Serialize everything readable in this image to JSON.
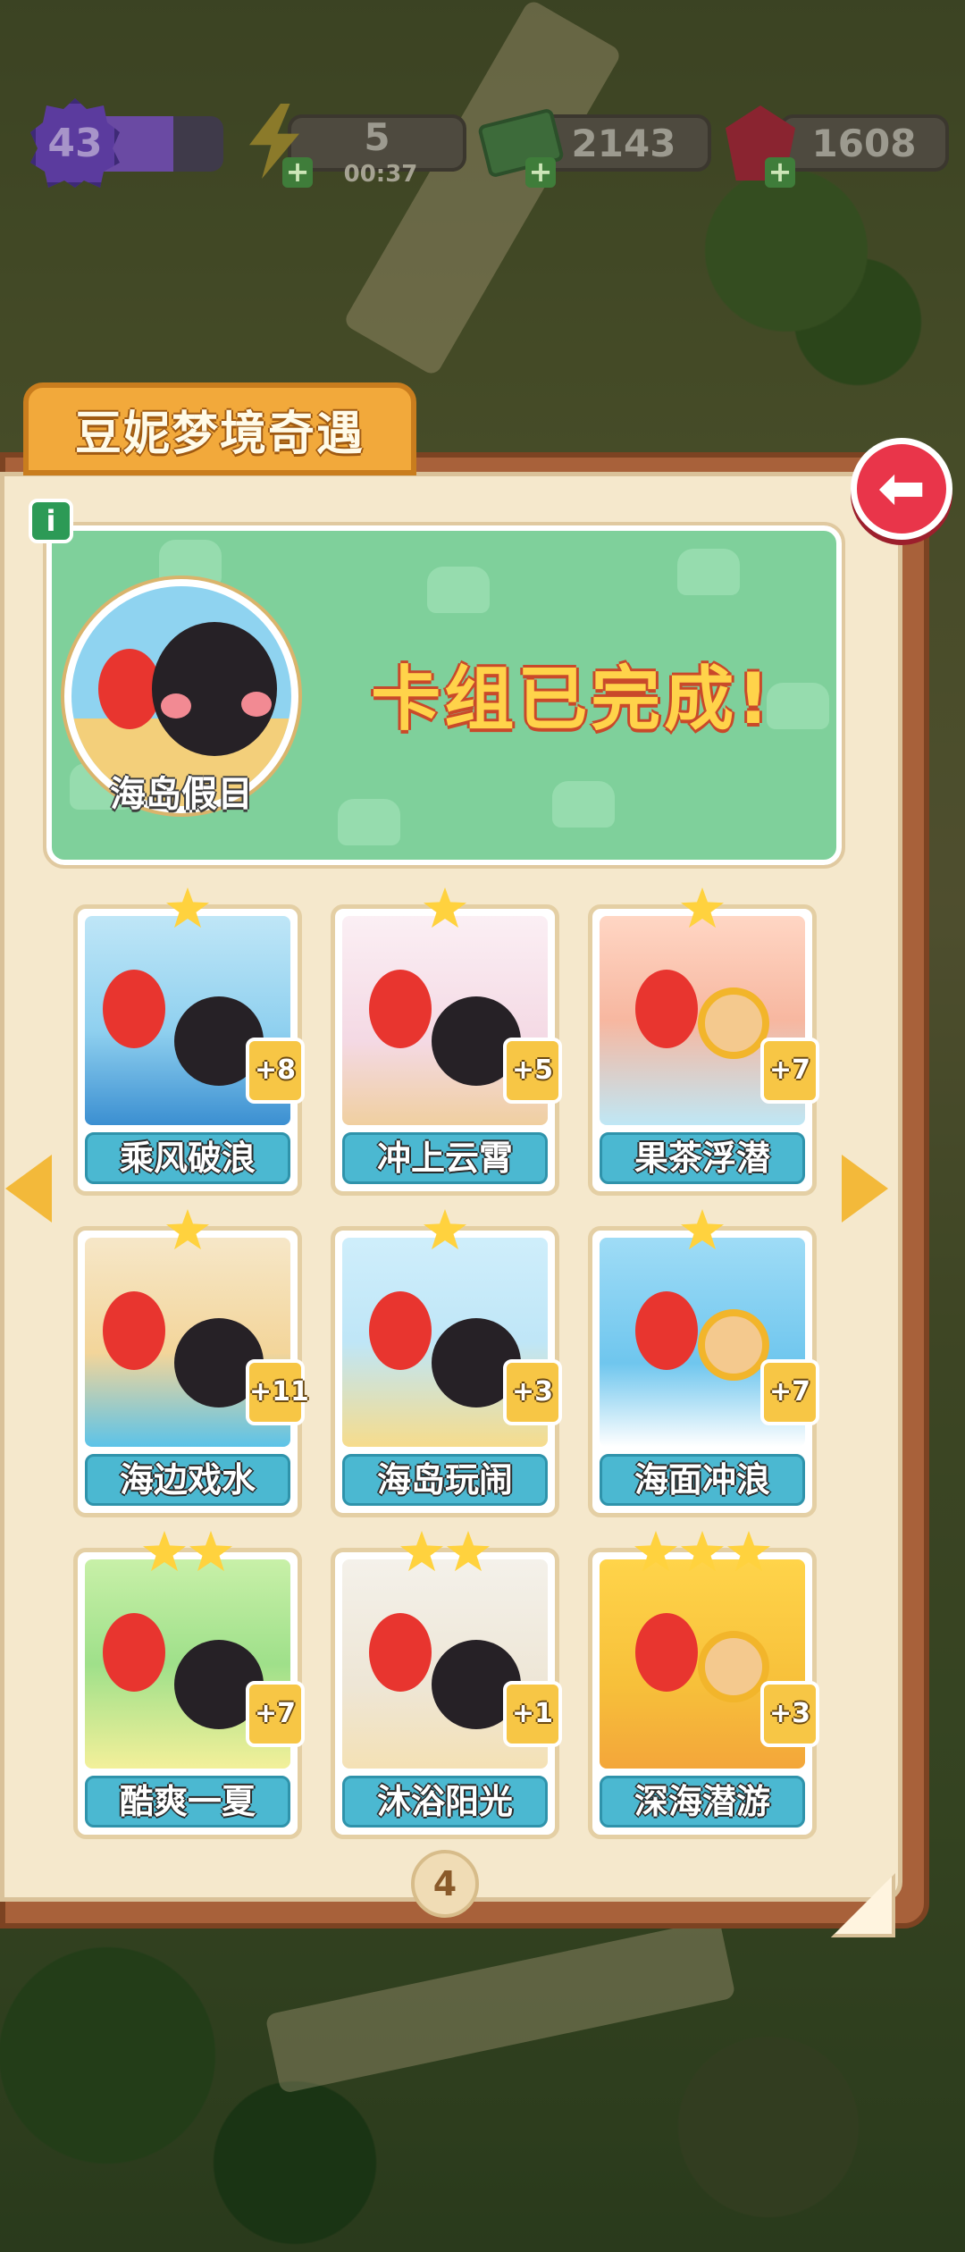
{
  "hud": {
    "level": "43",
    "level_progress": 0.6,
    "energy": "5",
    "energy_timer": "00:37",
    "cash": "2143",
    "gems": "1608"
  },
  "album": {
    "title": "豆妮梦境奇遇",
    "info_icon": "i",
    "close_icon": "back-arrow-icon",
    "set_name": "海岛假日",
    "completion_text": "卡组已完成!",
    "page_number": "4"
  },
  "cards": [
    {
      "name": "乘风破浪",
      "count": "+8",
      "stars": 1
    },
    {
      "name": "冲上云霄",
      "count": "+5",
      "stars": 1
    },
    {
      "name": "果茶浮潜",
      "count": "+7",
      "stars": 1
    },
    {
      "name": "海边戏水",
      "count": "+11",
      "stars": 1
    },
    {
      "name": "海岛玩闹",
      "count": "+3",
      "stars": 1
    },
    {
      "name": "海面冲浪",
      "count": "+7",
      "stars": 1
    },
    {
      "name": "酷爽一夏",
      "count": "+7",
      "stars": 2
    },
    {
      "name": "沐浴阳光",
      "count": "+1",
      "stars": 2
    },
    {
      "name": "深海潜游",
      "count": "+3",
      "stars": 3
    }
  ],
  "colors": {
    "accent_orange": "#f2a93b",
    "banner_green": "#7fd09b",
    "card_label_blue": "#4bb8d1",
    "close_red": "#e9354a",
    "star_yellow": "#ffd23e"
  }
}
